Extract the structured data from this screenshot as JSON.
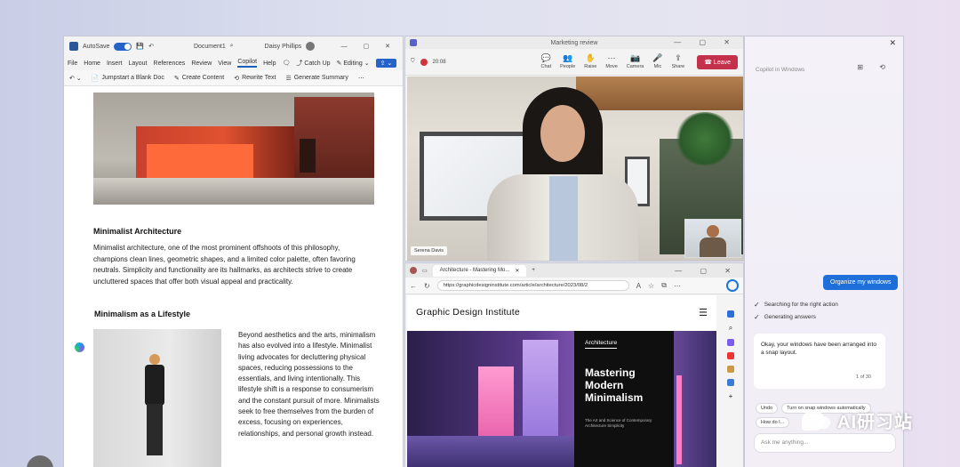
{
  "word": {
    "autosave_label": "AutoSave",
    "doc_name": "Document1",
    "user_name": "Daisy Phillips",
    "menu": [
      "File",
      "Home",
      "Insert",
      "Layout",
      "References",
      "Review",
      "View",
      "Copilot",
      "Help"
    ],
    "catch_up": "Catch Up",
    "editing": "Editing",
    "ribbon": [
      "Jumpstart a Blank Doc",
      "Create Content",
      "Rewrite Text",
      "Generate Summary"
    ],
    "heading1": "Minimalist Architecture",
    "para1": "Minimalist architecture, one of the most prominent offshoots of this philosophy, champions clean lines, geometric shapes, and a limited color palette, often favoring neutrals. Simplicity and functionality are its hallmarks, as architects strive to create uncluttered spaces that offer both visual appeal and practicality.",
    "heading2": "Minimalism as a Lifestyle",
    "para2": "Beyond aesthetics and the arts, minimalism has also evolved into a lifestyle. Minimalist living advocates for decluttering physical spaces, reducing possessions to the essentials, and living intentionally. This lifestyle shift is a response to consumerism and the constant pursuit of more. Minimalists seek to free themselves from the burden of excess, focusing on experiences, relationships, and personal growth instead."
  },
  "teams": {
    "title": "Marketing review",
    "time": "20:08",
    "controls": [
      "Chat",
      "People",
      "Raise",
      "Move",
      "Camera",
      "Mic",
      "Share"
    ],
    "leave": "Leave",
    "participant_name": "Serena Davis"
  },
  "edge": {
    "tab_title": "Architecture - Mastering Mo...",
    "url": "https://graphicdesigninstitute.com/article/architecture/2023/08/2",
    "site_name": "Graphic Design Institute",
    "card_tag": "Architecture",
    "card_title": "Mastering Modern Minimalism",
    "card_subtitle": "The Art and Science of Contemporary Architecture Simplicity"
  },
  "copilot": {
    "header_sub": "Copilot in Windows",
    "user_msg": "Organize my windows",
    "step1": "Searching for the right action",
    "step2": "Generating answers",
    "ai_msg": "Okay, your windows have been arranged into a snap layout.",
    "page": "1 of 30",
    "chip1": "Undo",
    "chip2": "Turn on snap windows automatically",
    "chip3": "How do I...",
    "ask_placeholder": "Ask me anything..."
  },
  "watermark": "AI研习站"
}
